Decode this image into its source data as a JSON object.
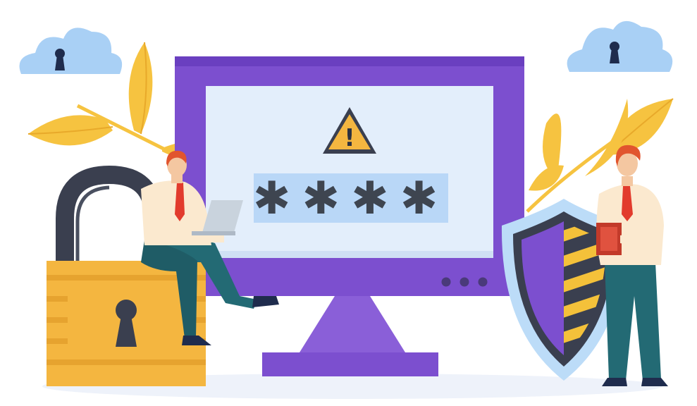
{
  "scene": {
    "subject": "password-security-illustration"
  },
  "monitor": {
    "password_mask": "✱✱✱✱",
    "warning_symbol": "!",
    "indicator_dots": 3
  },
  "colors": {
    "monitor_frame": "#7c4fcf",
    "monitor_frame_dark": "#5e36a8",
    "screen": "#e3eefb",
    "password_field": "#b9d7f7",
    "password_text": "#3e4550",
    "warning_fill": "#f4b640",
    "padlock_body": "#f4b640",
    "padlock_shackle": "#3a3f4f",
    "shield_outer": "#bcdcf8",
    "shield_purple": "#7c4fcf",
    "shield_stripe": "#f4c13a",
    "cloud": "#a9d0f5",
    "leaf": "#f6c340",
    "shirt": "#fbe9cf",
    "tie": "#e23b2d",
    "trousers": "#236a74",
    "hair": "#e1552e",
    "laptop": "#c9d3dd"
  },
  "icons": [
    "cloud-lock-icon",
    "warning-triangle-icon",
    "padlock-icon",
    "shield-icon",
    "laptop-icon",
    "clipboard-icon",
    "leaf-branch-icon"
  ]
}
